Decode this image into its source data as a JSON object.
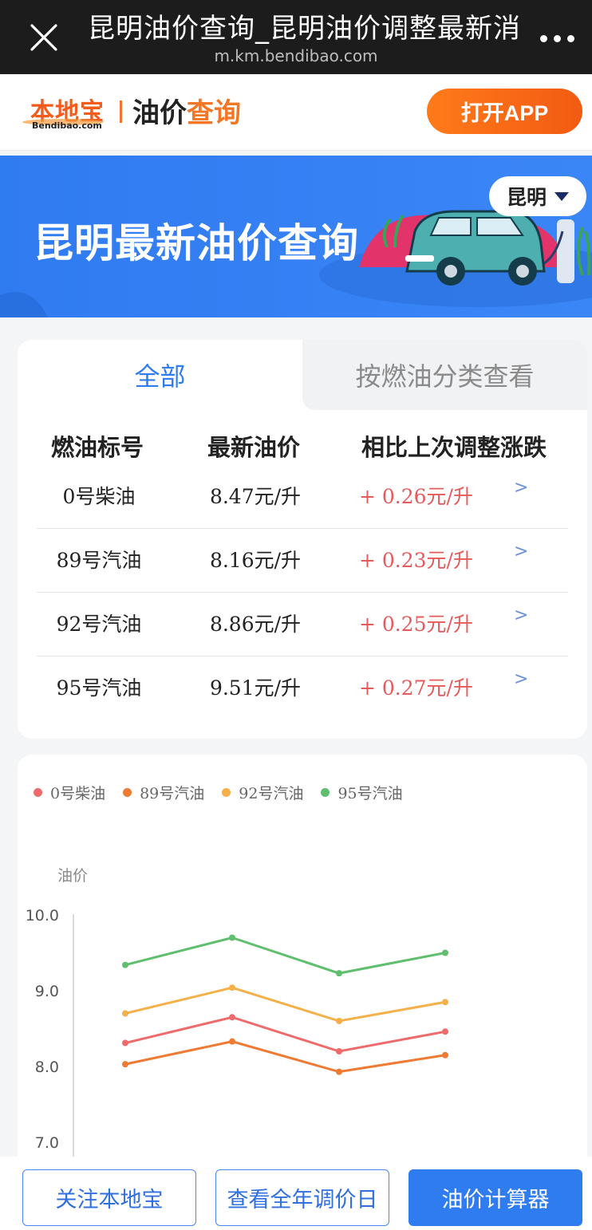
{
  "browser": {
    "title": "昆明油价查询_昆明油价调整最新消",
    "url": "m.km.bendibao.com",
    "close_icon": "close-icon",
    "more_icon": "more-dots-icon"
  },
  "header": {
    "logo_cn": "本地宝",
    "logo_en": "Bendibao.com",
    "brand_a": "油价",
    "brand_b": "查询",
    "open_app": "打开APP"
  },
  "banner": {
    "title": "昆明最新油价查询",
    "city": "昆明"
  },
  "tabs": {
    "all": "全部",
    "by_category": "按燃油分类查看"
  },
  "table": {
    "headers": [
      "燃油标号",
      "最新油价",
      "相比上次调整涨跌"
    ],
    "rows": [
      {
        "name": "0号柴油",
        "price": "8.47元/升",
        "change": "+ 0.26元/升",
        "arrow": ">"
      },
      {
        "name": "89号汽油",
        "price": "8.16元/升",
        "change": "+ 0.23元/升",
        "arrow": ">"
      },
      {
        "name": "92号汽油",
        "price": "8.86元/升",
        "change": "+ 0.25元/升",
        "arrow": ">"
      },
      {
        "name": "95号汽油",
        "price": "9.51元/升",
        "change": "+ 0.27元/升",
        "arrow": ">"
      }
    ]
  },
  "chart_data": {
    "type": "line",
    "ylabel": "油价",
    "ylim": [
      7.0,
      10.0
    ],
    "yticks": [
      "10.0",
      "9.0",
      "8.0",
      "7.0"
    ],
    "x": [
      1,
      2,
      3,
      4
    ],
    "series": [
      {
        "name": "0号柴油",
        "color": "#ef6b6b",
        "values": [
          8.31,
          8.65,
          8.2,
          8.46
        ]
      },
      {
        "name": "89号汽油",
        "color": "#ee7a33",
        "values": [
          8.03,
          8.33,
          7.93,
          8.15
        ]
      },
      {
        "name": "92号汽油",
        "color": "#f5b04a",
        "values": [
          8.7,
          9.04,
          8.6,
          8.85
        ]
      },
      {
        "name": "95号汽油",
        "color": "#5fbf6e",
        "values": [
          9.34,
          9.7,
          9.23,
          9.5
        ]
      }
    ],
    "grid": false,
    "legend": "top-left"
  },
  "bottom": {
    "follow": "关注本地宝",
    "calendar": "查看全年调价日",
    "calculator": "油价计算器"
  }
}
